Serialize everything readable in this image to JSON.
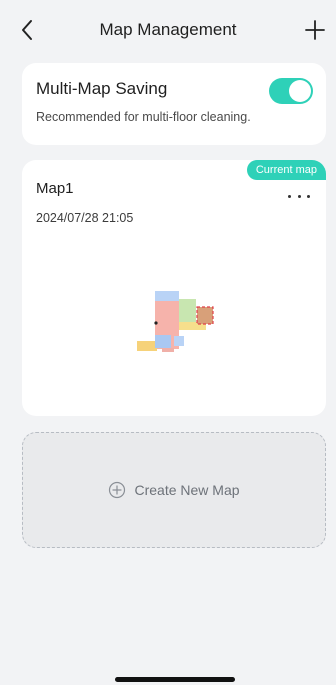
{
  "header": {
    "title": "Map Management",
    "back_icon": "chevron-left-icon",
    "add_icon": "plus-icon"
  },
  "multi_map": {
    "title": "Multi-Map Saving",
    "subtitle": "Recommended for multi-floor cleaning.",
    "enabled": true,
    "accent": "#2ed1b8"
  },
  "maps": [
    {
      "name": "Map1",
      "date": "2024/07/28 21:05",
      "badge": "Current map",
      "more_icon": "more-horizontal-icon"
    }
  ],
  "create": {
    "label": "Create New Map",
    "icon": "plus-circle-icon"
  }
}
